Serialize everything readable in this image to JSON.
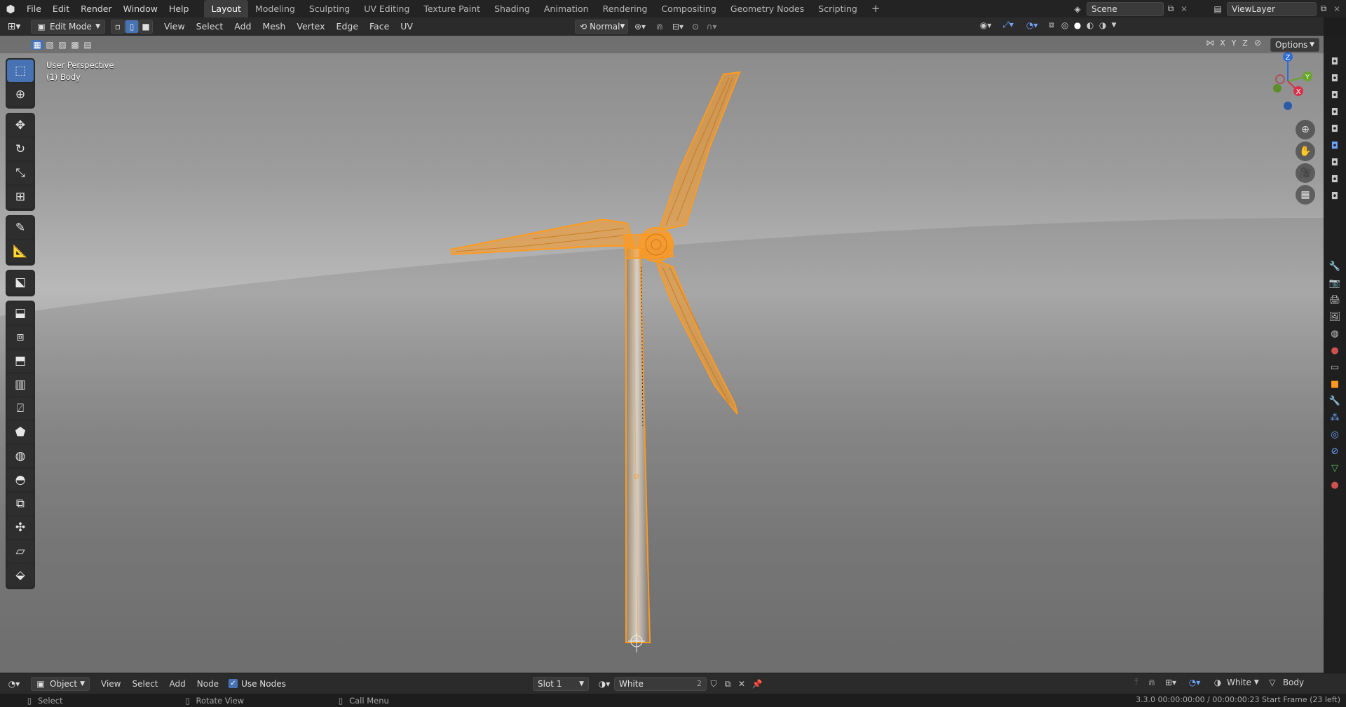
{
  "topbar": {
    "menus": [
      "File",
      "Edit",
      "Render",
      "Window",
      "Help"
    ],
    "workspaces": [
      "Layout",
      "Modeling",
      "Sculpting",
      "UV Editing",
      "Texture Paint",
      "Shading",
      "Animation",
      "Rendering",
      "Compositing",
      "Geometry Nodes",
      "Scripting"
    ],
    "active_workspace": "Layout",
    "add_tab": "+",
    "scene": "Scene",
    "view_layer": "ViewLayer"
  },
  "header": {
    "mode": "Edit Mode",
    "menus": [
      "View",
      "Select",
      "Add",
      "Mesh",
      "Vertex",
      "Edge",
      "Face",
      "UV"
    ],
    "orientation": "Normal",
    "options_label": "Options",
    "axis_x": "X",
    "axis_y": "Y",
    "axis_z": "Z"
  },
  "viewport": {
    "perspective_label": "User Perspective",
    "object_label": "(1) Body"
  },
  "gizmo": {
    "z": "Z",
    "y": "Y",
    "x": "X"
  },
  "bottom_header": {
    "editor_mode": "Object",
    "menus": [
      "View",
      "Select",
      "Add",
      "Node"
    ],
    "use_nodes_label": "Use Nodes",
    "use_nodes_checked": true,
    "slot": "Slot 1",
    "material": "White",
    "material_users": "2",
    "shading_material": "White",
    "object_name": "Body"
  },
  "statusbar": {
    "select": "Select",
    "rotate": "Rotate View",
    "call_menu": "Call Menu",
    "info": "3.3.0  00:00:00:00 / 00:00:00:23  Start Frame (23 left)"
  },
  "colors": {
    "accent": "#4772b3",
    "selection": "#ff9a1f"
  }
}
